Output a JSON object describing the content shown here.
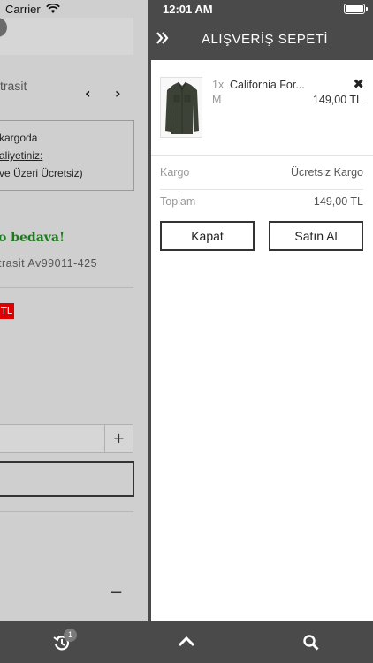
{
  "status_bar": {
    "carrier": "Carrier",
    "time": "12:01 AM"
  },
  "background_page": {
    "variant_text": "trasit",
    "shipping_line1": "kargoda",
    "shipping_line2": "aliyetiniz:",
    "shipping_line3": "ve Üzeri Ücretsiz)",
    "promo_text": "o bedava!",
    "product_code": "trasit Av99011-425",
    "price_badge": "TL",
    "plus_label": "+",
    "minus_label": "−"
  },
  "cart": {
    "title": "ALIŞVERİŞ SEPETİ",
    "items": [
      {
        "quantity": "1x",
        "name": "California For...",
        "size": "M",
        "price": "149,00 TL"
      }
    ],
    "summary": {
      "shipping_label": "Kargo",
      "shipping_value": "Ücretsiz Kargo",
      "total_label": "Toplam",
      "total_value": "149,00 TL"
    },
    "buttons": {
      "close": "Kapat",
      "buy": "Satın Al"
    }
  },
  "toolbar": {
    "history_badge": "1"
  },
  "icons": {
    "close_drawer": "double-chevron-right-icon",
    "remove_item": "close-icon",
    "history": "history-icon",
    "scroll_top": "chevron-up-icon",
    "search": "search-icon"
  },
  "colors": {
    "header_bg": "#4a4a4a",
    "dim_overlay": "#cfcfcf",
    "promo_green": "#1f7a1f",
    "price_badge_red": "#dd0000"
  }
}
